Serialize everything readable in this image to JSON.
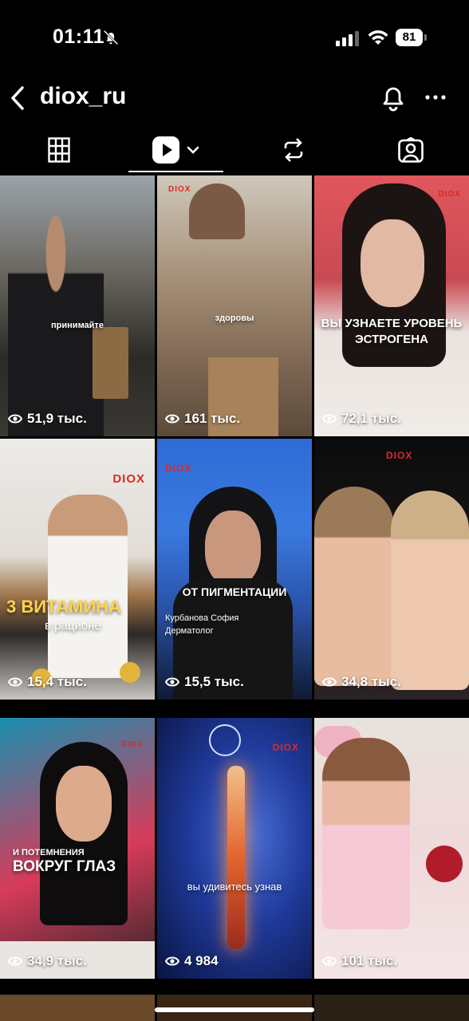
{
  "status": {
    "time": "01:11",
    "battery": "81"
  },
  "header": {
    "username": "diox_ru"
  },
  "tabs": [
    "grid",
    "reels",
    "reposts",
    "tagged"
  ],
  "colors": {
    "background": "#000000",
    "accent": "#ffffff",
    "logo_red": "#d92a2a"
  },
  "tiles": [
    {
      "views": "51,9 тыс.",
      "caption": "принимайте"
    },
    {
      "views": "161 тыс.",
      "caption": "здоровы",
      "logo": "DIOX"
    },
    {
      "views": "72,1 тыс.",
      "caption": "ВЫ УЗНАЕТЕ УРОВЕНЬ ЭСТРОГЕНА",
      "logo": "DIOX"
    },
    {
      "views": "15,4 тыс.",
      "caption_line1": "3 ВИТАМИНА",
      "caption_line2": "в рационе",
      "logo": "DIOX"
    },
    {
      "views": "15,5 тыс.",
      "caption": "ОТ ПИГМЕНТАЦИИ",
      "subtitle_line1": "Курбанова София",
      "subtitle_line2": "Дерматолог",
      "logo": "DIOX"
    },
    {
      "views": "34,8 тыс.",
      "logo": "DIOX"
    },
    {
      "views": "34,9 тыс.",
      "caption_line1": "И ПОТЕМНЕНИЯ",
      "caption_line2": "ВОКРУГ ГЛАЗ",
      "logo": "DIOX"
    },
    {
      "views": "4 984",
      "caption": "вы удивитесь узнав",
      "logo": "DIOX"
    },
    {
      "views": "101 тыс."
    }
  ]
}
